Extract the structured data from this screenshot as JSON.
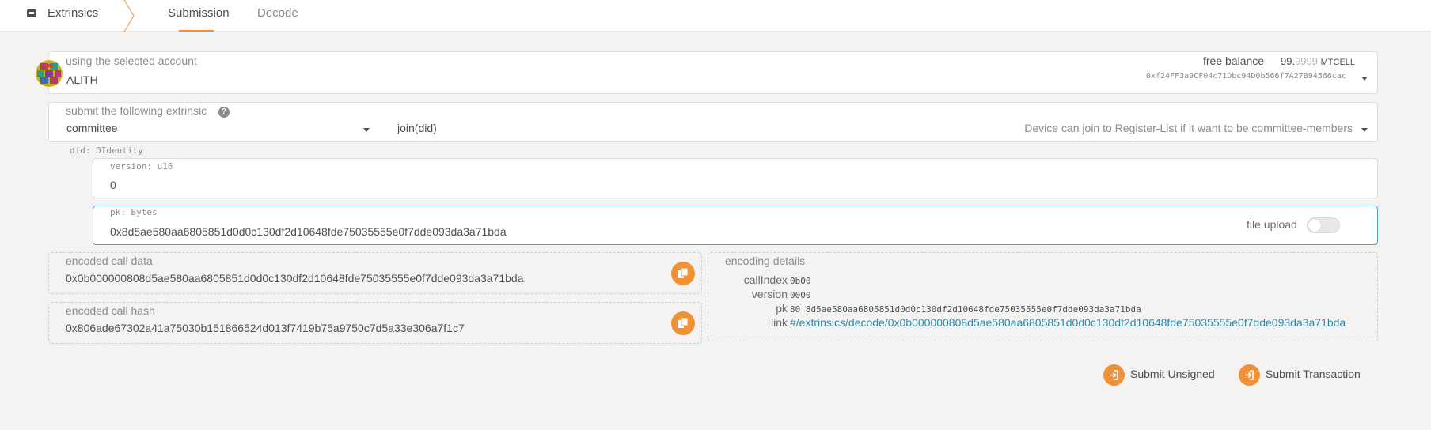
{
  "header": {
    "section_title": "Extrinsics",
    "tabs": [
      {
        "label": "Submission"
      },
      {
        "label": "Decode"
      }
    ]
  },
  "account": {
    "label": "using the selected account",
    "name": "ALITH",
    "balance_label": "free balance",
    "balance_int": "99.",
    "balance_frac": "9999",
    "balance_unit": "MTCELL",
    "address": "0xf24FF3a9CF04c71Dbc94D0b566f7A27B94566cac"
  },
  "extrinsic": {
    "label": "submit the following extrinsic",
    "help": "?",
    "section": "committee",
    "method": "join(did)",
    "description": "Device can join to Register-List if it want to be committee-members"
  },
  "params": {
    "did_label": "did: DIdentity",
    "version_label": "version: u16",
    "version_value": "0",
    "pk_label": "pk: Bytes",
    "pk_value": "0x8d5ae580aa6805851d0d0c130df2d10648fde75035555e0f7dde093da3a71bda",
    "file_upload_label": "file upload"
  },
  "encoded": {
    "call_data_label": "encoded call data",
    "call_data": "0x0b000000808d5ae580aa6805851d0d0c130df2d10648fde75035555e0f7dde093da3a71bda",
    "call_hash_label": "encoded call hash",
    "call_hash": "0x806ade67302a41a75030b151866524d013f7419b75a9750c7d5a33e306a7f1c7"
  },
  "encoding_details": {
    "title": "encoding details",
    "rows": [
      {
        "key": "callIndex",
        "value": "0b00"
      },
      {
        "key": "version",
        "value": "0000"
      },
      {
        "key": "pk",
        "value": "80 8d5ae580aa6805851d0d0c130df2d10648fde75035555e0f7dde093da3a71bda"
      }
    ],
    "link_key": "link",
    "link": "#/extrinsics/decode/0x0b000000808d5ae580aa6805851d0d0c130df2d10648fde75035555e0f7dde093da3a71bda"
  },
  "actions": {
    "submit_unsigned": "Submit Unsigned",
    "submit_transaction": "Submit Transaction"
  },
  "colors": {
    "accent": "#f19135",
    "link": "#2e8aa8",
    "background": "#f4f3f2"
  }
}
